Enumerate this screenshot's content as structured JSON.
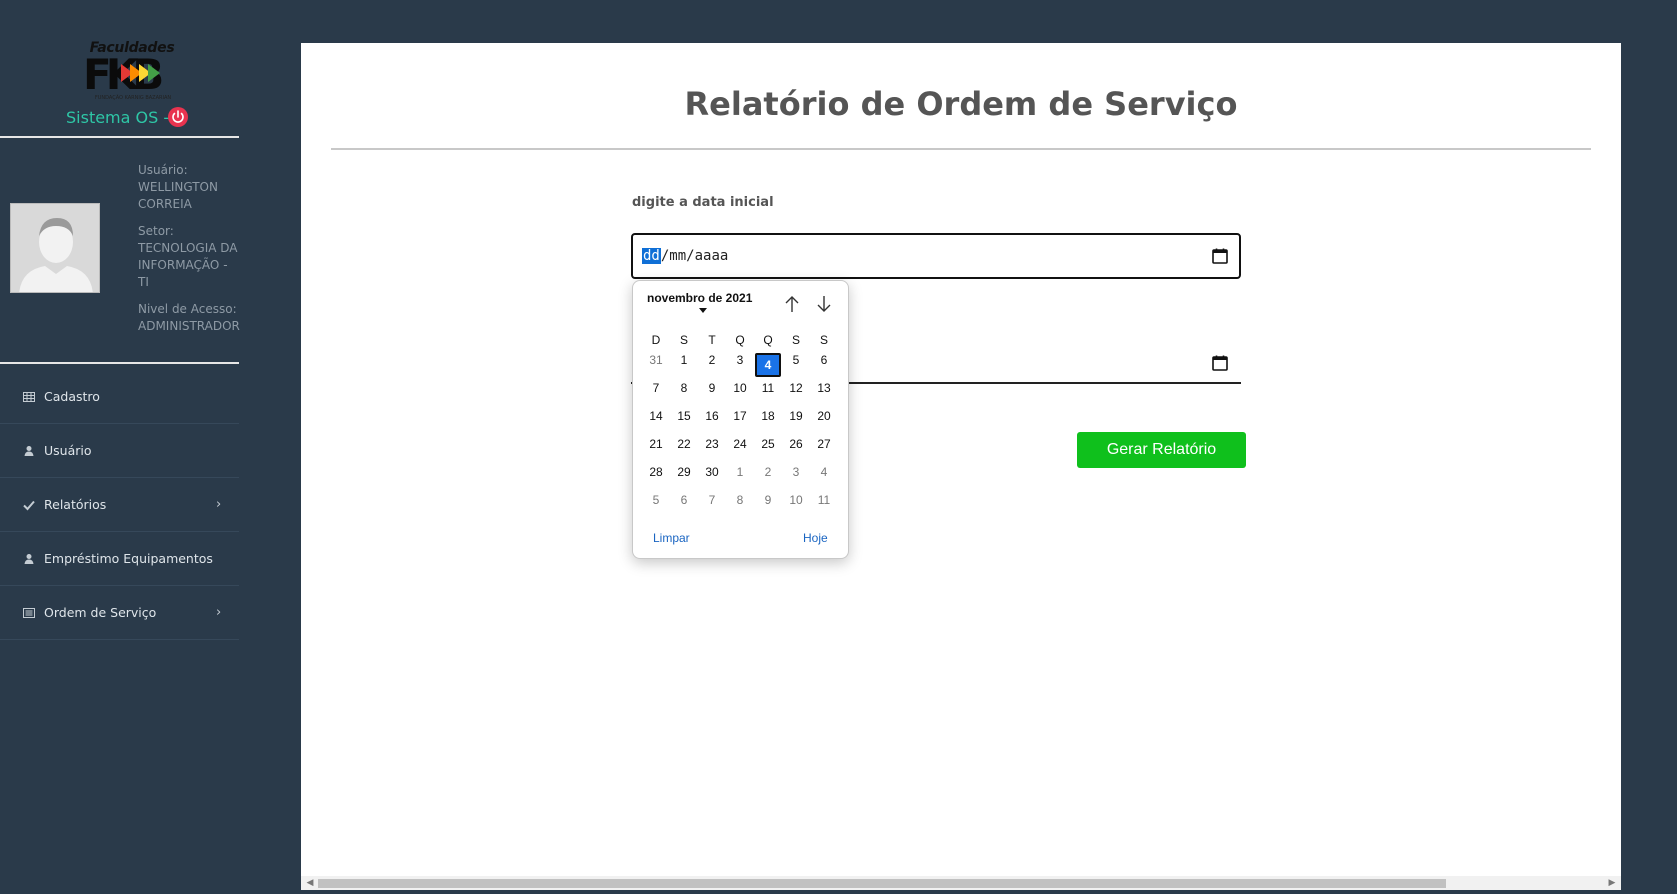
{
  "sidebar": {
    "logo": {
      "top_text": "Faculdades",
      "mark": "FKB",
      "sub_text": "FUNDAÇÃO KARNIG BAZARIAN"
    },
    "app_title": "Sistema OS -",
    "user": {
      "user_label": "Usuário:",
      "user_name": "WELLINGTON CORREIA",
      "sector_label": "Setor:",
      "sector_name": "TECNOLOGIA DA INFORMAÇÃO - TI",
      "access_label": "Nivel de Acesso:",
      "access_name": "ADMINISTRADOR"
    },
    "nav": [
      {
        "label": "Cadastro",
        "icon": "table-icon",
        "has_children": false
      },
      {
        "label": "Usuário",
        "icon": "user-icon",
        "has_children": false
      },
      {
        "label": "Relatórios",
        "icon": "check-icon",
        "has_children": true
      },
      {
        "label": "Empréstimo Equipamentos",
        "icon": "user-icon",
        "has_children": false
      },
      {
        "label": "Ordem de Serviço",
        "icon": "list-icon",
        "has_children": true
      }
    ]
  },
  "main": {
    "title": "Relatório de Ordem de Serviço",
    "start_date": {
      "label": "digite a data inicial",
      "placeholder_dd": "dd",
      "placeholder_mm": "mm",
      "placeholder_yyyy": "aaaa"
    },
    "generate_button": "Gerar Relatório"
  },
  "datepicker": {
    "month_label": "novembro de 2021",
    "weekdays": [
      "D",
      "S",
      "T",
      "Q",
      "Q",
      "S",
      "S"
    ],
    "weeks": [
      [
        "31",
        "1",
        "2",
        "3",
        "4",
        "5",
        "6"
      ],
      [
        "7",
        "8",
        "9",
        "10",
        "11",
        "12",
        "13"
      ],
      [
        "14",
        "15",
        "16",
        "17",
        "18",
        "19",
        "20"
      ],
      [
        "21",
        "22",
        "23",
        "24",
        "25",
        "26",
        "27"
      ],
      [
        "28",
        "29",
        "30",
        "1",
        "2",
        "3",
        "4"
      ],
      [
        "5",
        "6",
        "7",
        "8",
        "9",
        "10",
        "11"
      ]
    ],
    "selected_day": "4",
    "clear_label": "Limpar",
    "today_label": "Hoje"
  },
  "colors": {
    "sidebar_bg": "#2a3a4a",
    "accent_teal": "#2ec6a6",
    "power_red": "#e8334f",
    "button_green": "#0fc01c",
    "selected_blue": "#1a73e8"
  }
}
